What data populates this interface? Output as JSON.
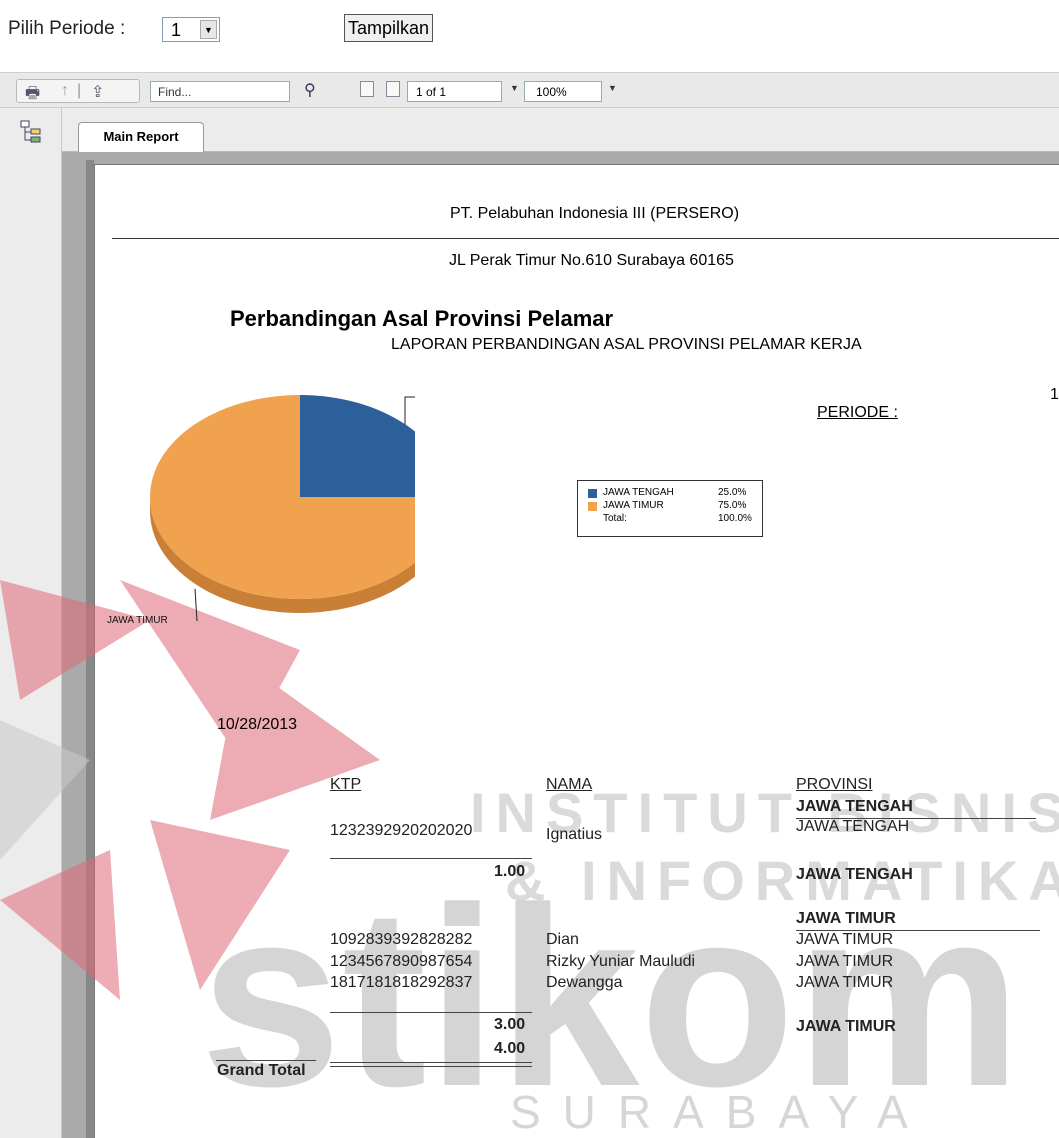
{
  "filter": {
    "period_label": "Pilih Periode :",
    "period_value": "1",
    "show_button": "Tampilkan"
  },
  "toolbar": {
    "find_placeholder": "Find...",
    "page_indicator": "1 of 1",
    "zoom": "100%"
  },
  "tabs": {
    "main": "Main Report"
  },
  "report": {
    "company": "PT. Pelabuhan Indonesia III (PERSERO)",
    "address": "JL Perak Timur No.610 Surabaya 60165",
    "title": "Perbandingan Asal Provinsi Pelamar",
    "subtitle": "LAPORAN PERBANDINGAN ASAL PROVINSI PELAMAR KERJA",
    "periode_label": "PERIODE :",
    "periode_value": "1",
    "date": "10/28/2013",
    "columns": {
      "ktp": "KTP",
      "nama": "NAMA",
      "provinsi": "PROVINSI"
    },
    "groups": [
      {
        "name": "JAWA TENGAH",
        "rows": [
          {
            "ktp": "1232392920202020",
            "nama": "Ignatius",
            "provinsi": "JAWA TENGAH"
          }
        ],
        "count": "1.00",
        "footer": "JAWA TENGAH"
      },
      {
        "name": "JAWA TIMUR",
        "rows": [
          {
            "ktp": "1092839392828282",
            "nama": "Dian",
            "provinsi": "JAWA TIMUR"
          },
          {
            "ktp": "1234567890987654",
            "nama": "Rizky Yuniar Mauludi",
            "provinsi": "JAWA TIMUR"
          },
          {
            "ktp": "1817181818292837",
            "nama": "Dewangga",
            "provinsi": "JAWA TIMUR"
          }
        ],
        "count": "3.00",
        "footer": "JAWA TIMUR"
      }
    ],
    "grand_total_label": "Grand Total",
    "grand_total": "4.00"
  },
  "chart_data": {
    "type": "pie",
    "categories": [
      "JAWA TENGAH",
      "JAWA TIMUR"
    ],
    "values": [
      25.0,
      75.0
    ],
    "labels": [
      "JAWA TENGAH",
      "JAWA TIMUR"
    ],
    "legend": [
      {
        "name": "JAWA TENGAH",
        "pct": "25.0%"
      },
      {
        "name": "JAWA TIMUR",
        "pct": "75.0%"
      },
      {
        "name": "Total:",
        "pct": "100.0%"
      }
    ],
    "colors": [
      "#2d5f9a",
      "#f0a24e"
    ],
    "legend_position": "right"
  },
  "watermark": {
    "line1": "INSTITUT BISNIS",
    "line2": "& INFORMATIKA",
    "brand": "stikom",
    "city": "SURABAYA",
    "colors": {
      "red": "#e06a78",
      "gray": "#bdbdbd"
    }
  }
}
